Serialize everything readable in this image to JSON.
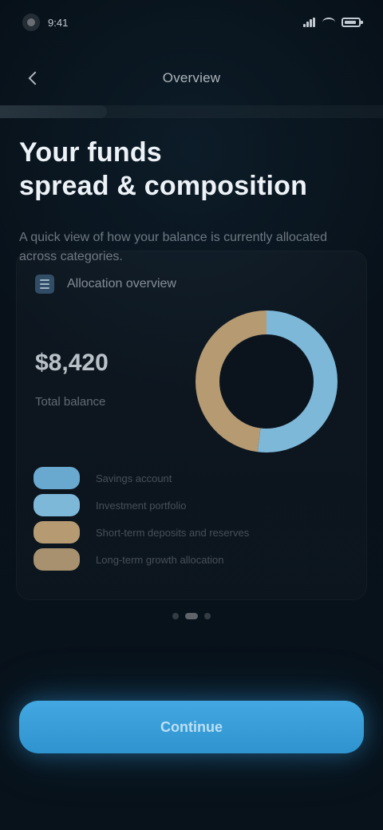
{
  "statusbar": {
    "time": "9:41"
  },
  "topbar": {
    "title": "Overview"
  },
  "progress": {
    "value": 0.28
  },
  "header": {
    "line1": "Your funds",
    "line2": "spread & composition",
    "subtitle": "A quick view of how your balance is currently allocated across categories."
  },
  "card": {
    "info_label": "Allocation overview",
    "metric_value": "$8,420",
    "metric_label": "Total balance",
    "legend": [
      {
        "label": "Savings account",
        "color": "#69a8cf"
      },
      {
        "label": "Investment portfolio",
        "color": "#7eb8d9"
      },
      {
        "label": "Short-term deposits and reserves",
        "color": "#b59a72"
      },
      {
        "label": "Long-term growth allocation",
        "color": "#a7916e"
      }
    ],
    "donut": {
      "segments": [
        {
          "value": 0.52,
          "color": "#7eb8d9"
        },
        {
          "value": 0.48,
          "color": "#b59a72"
        }
      ]
    }
  },
  "pager": {
    "current": 2,
    "total": 3
  },
  "cta": {
    "label": "Continue"
  }
}
